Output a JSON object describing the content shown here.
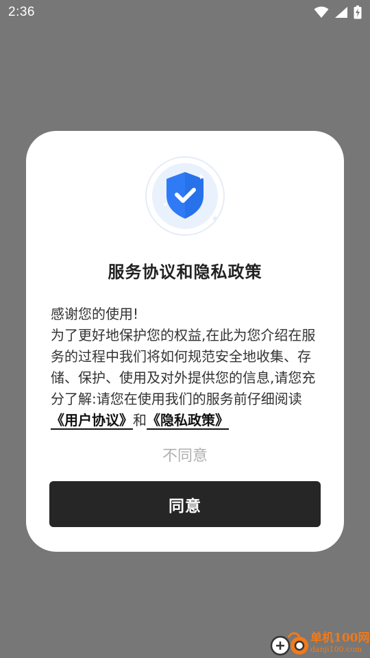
{
  "status_bar": {
    "time": "2:36"
  },
  "dialog": {
    "title": "服务协议和隐私政策",
    "greeting": "感谢您的使用!",
    "body_text": "为了更好地保护您的权益,在此为您介绍在服务的过程中我们将如何规范安全地收集、存储、保护、使用及对外提供您的信息,请您充分了解:请您在使用我们的服务前仔细阅读",
    "user_agreement_link": "《用户协议》",
    "and_text": "和",
    "privacy_policy_link": "《隐私政策》",
    "disagree_label": "不同意",
    "agree_label": "同意"
  },
  "watermark": {
    "cn": "单机100网",
    "en": "danji100.com"
  },
  "colors": {
    "overlay": "#777777",
    "dialog_bg": "#ffffff",
    "agree_bg": "#262626",
    "shield_blue": "#2f7bf5",
    "watermark_orange": "#f07a1a"
  }
}
